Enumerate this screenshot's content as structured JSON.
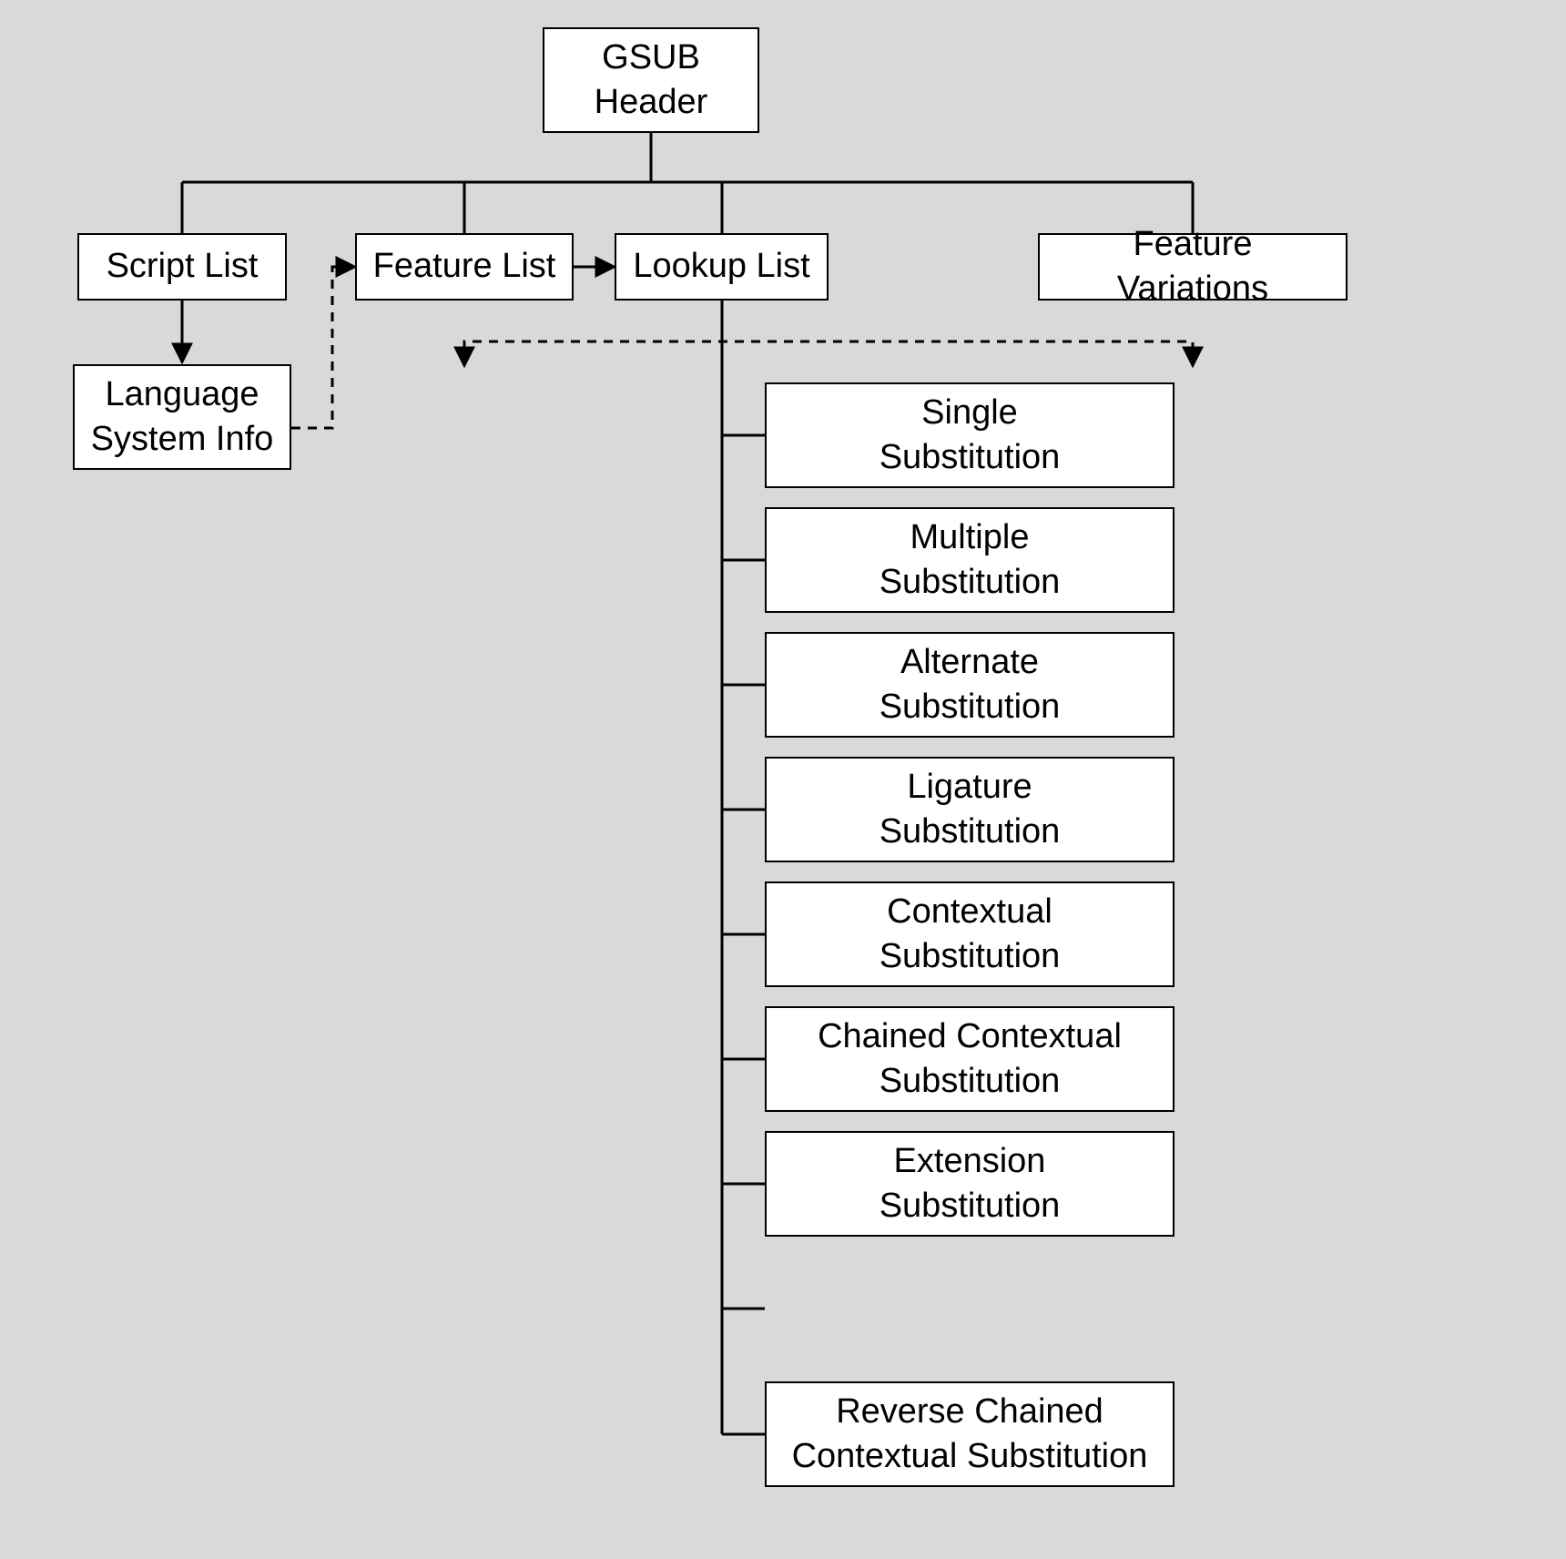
{
  "gsub_header": "GSUB\nHeader",
  "script_list": "Script List",
  "feature_list": "Feature List",
  "lookup_list": "Lookup List",
  "feature_variations": "Feature Variations",
  "language_system_info": "Language\nSystem Info",
  "lookup_types": [
    "Single\nSubstitution",
    "Multiple\nSubstitution",
    "Alternate\nSubstitution",
    "Ligature\nSubstitution",
    "Contextual\nSubstitution",
    "Chained Contextual\nSubstitution",
    "Extension\nSubstitution",
    "Reverse Chained\nContextual Substitution"
  ]
}
